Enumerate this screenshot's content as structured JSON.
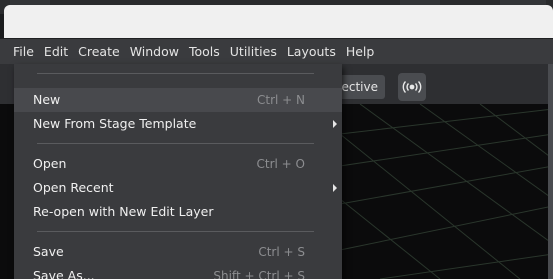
{
  "menubar": {
    "items": [
      "File",
      "Edit",
      "Create",
      "Window",
      "Tools",
      "Utilities",
      "Layouts",
      "Help"
    ]
  },
  "toolbar": {
    "camera_label": "Perspective",
    "camera_label_visible": "pective"
  },
  "file_menu": {
    "groups": [
      [
        {
          "label": "New",
          "shortcut": "Ctrl + N",
          "submenu": false,
          "highlighted": true
        },
        {
          "label": "New From Stage Template",
          "shortcut": "",
          "submenu": true
        }
      ],
      [
        {
          "label": "Open",
          "shortcut": "Ctrl + O",
          "submenu": false
        },
        {
          "label": "Open Recent",
          "shortcut": "",
          "submenu": true
        },
        {
          "label": "Re-open with New Edit Layer",
          "shortcut": "",
          "submenu": false
        }
      ],
      [
        {
          "label": "Save",
          "shortcut": "Ctrl + S",
          "submenu": false
        },
        {
          "label": "Save As...",
          "shortcut": "Shift + Ctrl + S",
          "submenu": false
        }
      ]
    ]
  },
  "colors": {
    "menu_bg": "#3a3b3e",
    "menu_highlight": "#48494d",
    "viewport_bg": "#0b0b0c",
    "grid_line": "#2c3a2e"
  }
}
